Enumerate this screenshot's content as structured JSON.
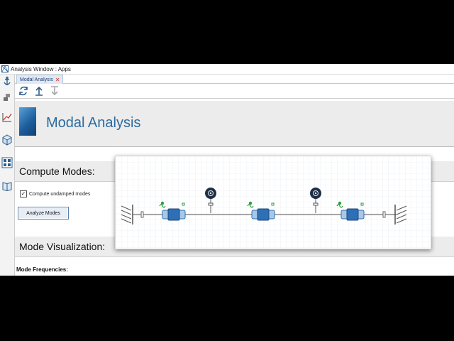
{
  "window": {
    "title": "Analysis Window : Apps"
  },
  "tabs": [
    {
      "label": "Modal Analysis",
      "close": "✕"
    }
  ],
  "toolbar": {
    "icons": [
      "refresh-icon",
      "upload-arrow-icon",
      "download-arrow-icon"
    ]
  },
  "sidebar": {
    "icons": [
      "anchor-icon",
      "blocks-icon",
      "chart-icon",
      "cube-icon",
      "grid-icon",
      "book-icon"
    ]
  },
  "header": {
    "title": "Modal Analysis"
  },
  "compute": {
    "title": "Compute Modes:",
    "checkbox_label": "Compute undamped modes",
    "checked": true,
    "button_label": "Analyze Modes"
  },
  "visualization": {
    "title": "Mode Visualization:"
  },
  "frequencies": {
    "label": "Mode Frequencies:"
  },
  "colors": {
    "accent": "#2b6a9e",
    "mass": "#2f6fb5",
    "sensor": "#1f2f45",
    "spring": "#2e9e3e"
  }
}
